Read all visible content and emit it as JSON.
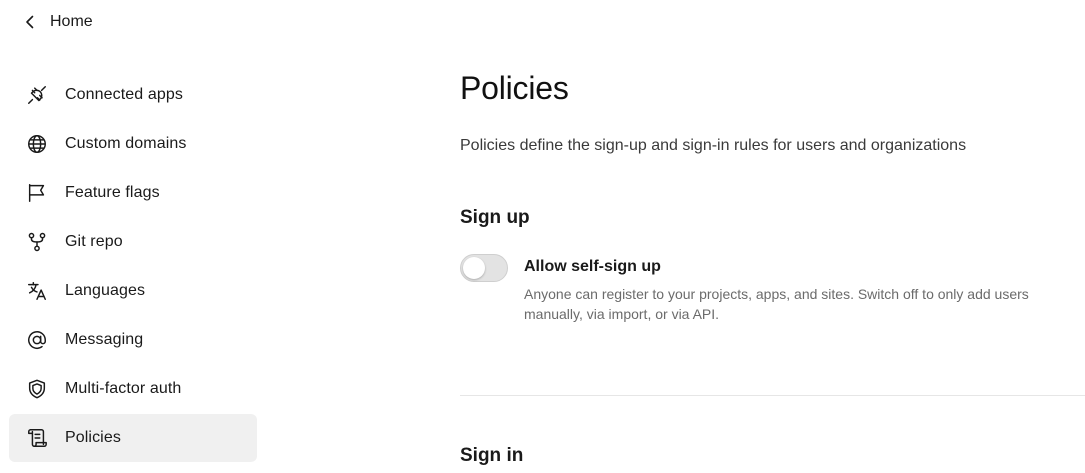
{
  "nav": {
    "back_label": "Home",
    "items": [
      {
        "label": "Connected apps",
        "icon": "plug-icon"
      },
      {
        "label": "Custom domains",
        "icon": "globe-icon"
      },
      {
        "label": "Feature flags",
        "icon": "flag-icon"
      },
      {
        "label": "Git repo",
        "icon": "git-branch-icon"
      },
      {
        "label": "Languages",
        "icon": "translate-icon"
      },
      {
        "label": "Messaging",
        "icon": "at-sign-icon"
      },
      {
        "label": "Multi-factor auth",
        "icon": "shield-icon"
      },
      {
        "label": "Policies",
        "icon": "scroll-icon",
        "active": true
      }
    ]
  },
  "main": {
    "title": "Policies",
    "description": "Policies define the sign-up and sign-in rules for users and organizations",
    "signup": {
      "title": "Sign up",
      "self_signup": {
        "label": "Allow self-sign up",
        "description": "Anyone can register to your projects, apps, and sites. Switch off to only add users manually, via import, or via API.",
        "enabled": false
      }
    },
    "signin": {
      "title": "Sign in"
    }
  },
  "colors": {
    "active_bg": "#f0f0f0",
    "toggle_off": "#e3e3e3",
    "muted_text": "#6b6b6b"
  }
}
